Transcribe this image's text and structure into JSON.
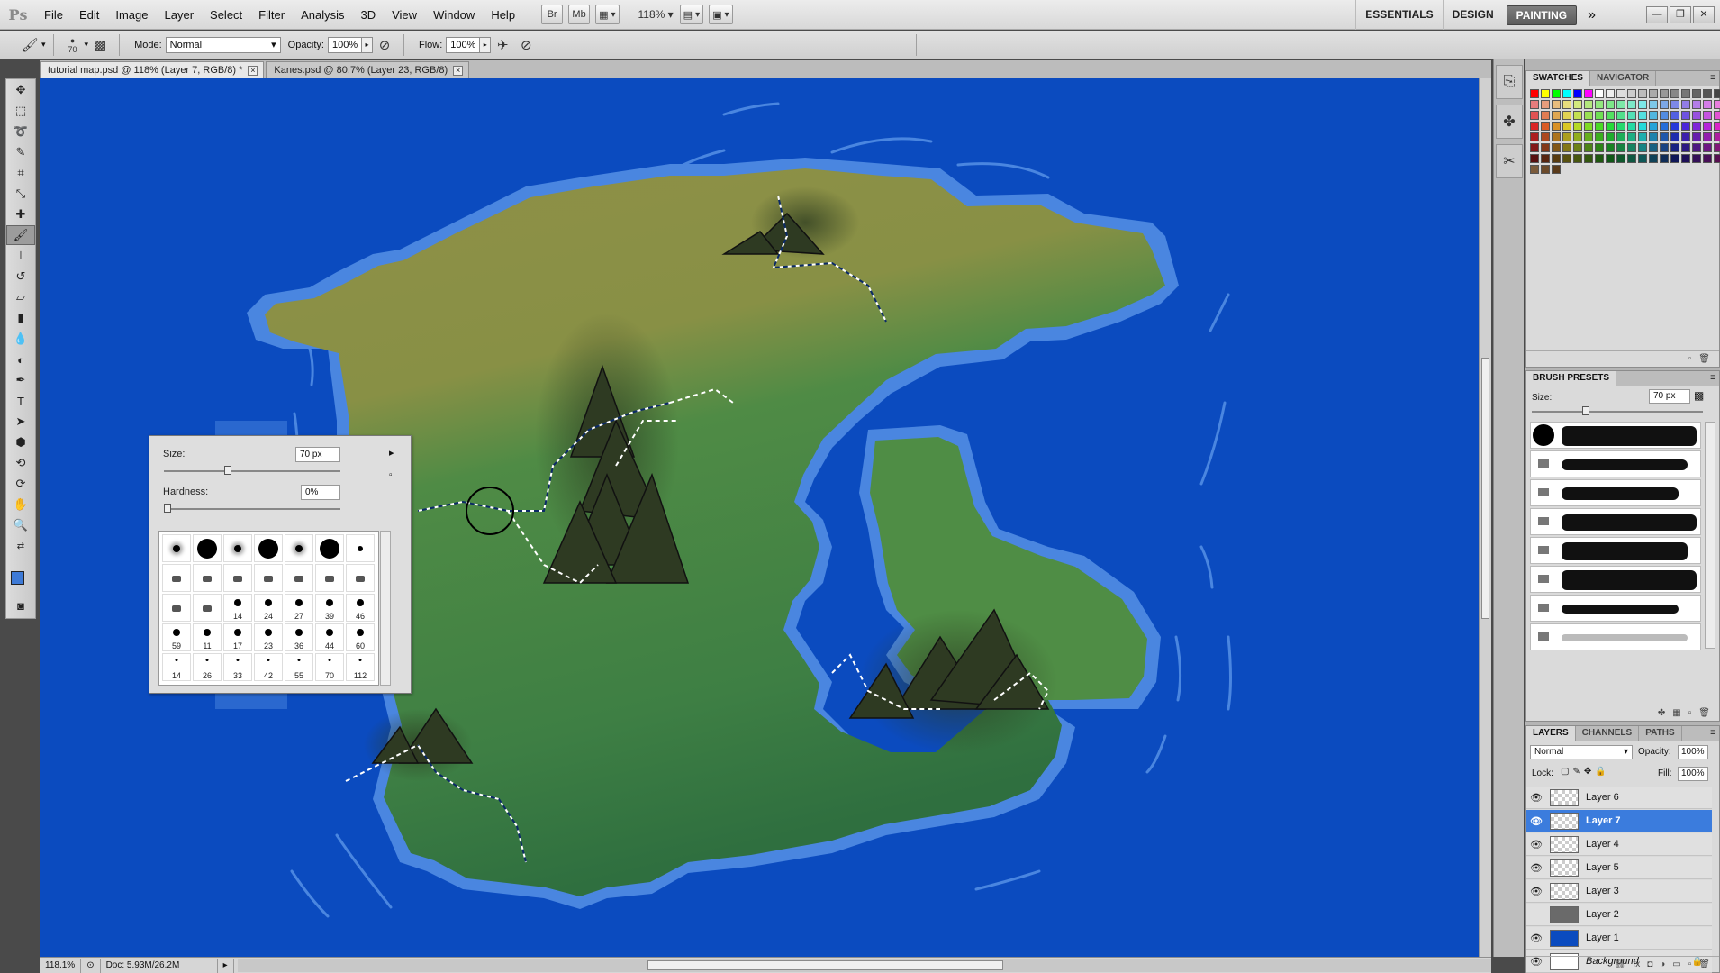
{
  "app": {
    "logo": "Ps"
  },
  "menu": [
    "File",
    "Edit",
    "Image",
    "Layer",
    "Select",
    "Filter",
    "Analysis",
    "3D",
    "View",
    "Window",
    "Help"
  ],
  "app_bar": {
    "bridge": "Br",
    "mini_bridge": "Mb",
    "zoom": "118%"
  },
  "workspaces": {
    "essentials": "ESSENTIALS",
    "design": "DESIGN",
    "painting": "PAINTING",
    "more": "»"
  },
  "options": {
    "brush_size": "70",
    "mode_label": "Mode:",
    "mode_value": "Normal",
    "opacity_label": "Opacity:",
    "opacity_value": "100%",
    "flow_label": "Flow:",
    "flow_value": "100%"
  },
  "tabs": [
    {
      "label": "tutorial map.psd @ 118% (Layer 7, RGB/8) *"
    },
    {
      "label": "Kanes.psd @ 80.7% (Layer 23, RGB/8)"
    }
  ],
  "status": {
    "zoom": "118.1%",
    "doc": "Doc: 5.93M/26.2M"
  },
  "brush_picker": {
    "size_label": "Size:",
    "size_value": "70 px",
    "hardness_label": "Hardness:",
    "hardness_value": "0%",
    "size_fraction": 0.35,
    "hardness_fraction": 0.0,
    "tip_labels": [
      "14",
      "24",
      "27",
      "39",
      "46",
      "59",
      "11",
      "17",
      "23",
      "36",
      "44",
      "60",
      "14",
      "26",
      "33",
      "42",
      "55",
      "70",
      "112"
    ]
  },
  "swatches_panel": {
    "tab_swatches": "SWATCHES",
    "tab_navigator": "NAVIGATOR"
  },
  "brush_presets": {
    "title": "BRUSH PRESETS",
    "size_label": "Size:",
    "size_value": "70 px"
  },
  "layers_panel": {
    "tab_layers": "LAYERS",
    "tab_channels": "CHANNELS",
    "tab_paths": "PATHS",
    "blend_mode": "Normal",
    "opacity_label": "Opacity:",
    "opacity_value": "100%",
    "lock_label": "Lock:",
    "fill_label": "Fill:",
    "fill_value": "100%",
    "layers": [
      {
        "name": "Layer 6",
        "visible": true,
        "active": false
      },
      {
        "name": "Layer 7",
        "visible": true,
        "active": true
      },
      {
        "name": "Layer 4",
        "visible": true,
        "active": false
      },
      {
        "name": "Layer 5",
        "visible": true,
        "active": false
      },
      {
        "name": "Layer 3",
        "visible": true,
        "active": false
      },
      {
        "name": "Layer 2",
        "visible": false,
        "active": false
      },
      {
        "name": "Layer 1",
        "visible": true,
        "active": false
      },
      {
        "name": "Background",
        "visible": true,
        "active": false,
        "locked": true
      }
    ]
  },
  "colors": {
    "foreground": "#3e7ad6",
    "background": "#ffffff",
    "ocean": "#0b4bbf",
    "coast": "#4a86e0",
    "land_green": "#4e8c44",
    "land_olive": "#8b8b45",
    "selection": "#3b7cdd"
  }
}
